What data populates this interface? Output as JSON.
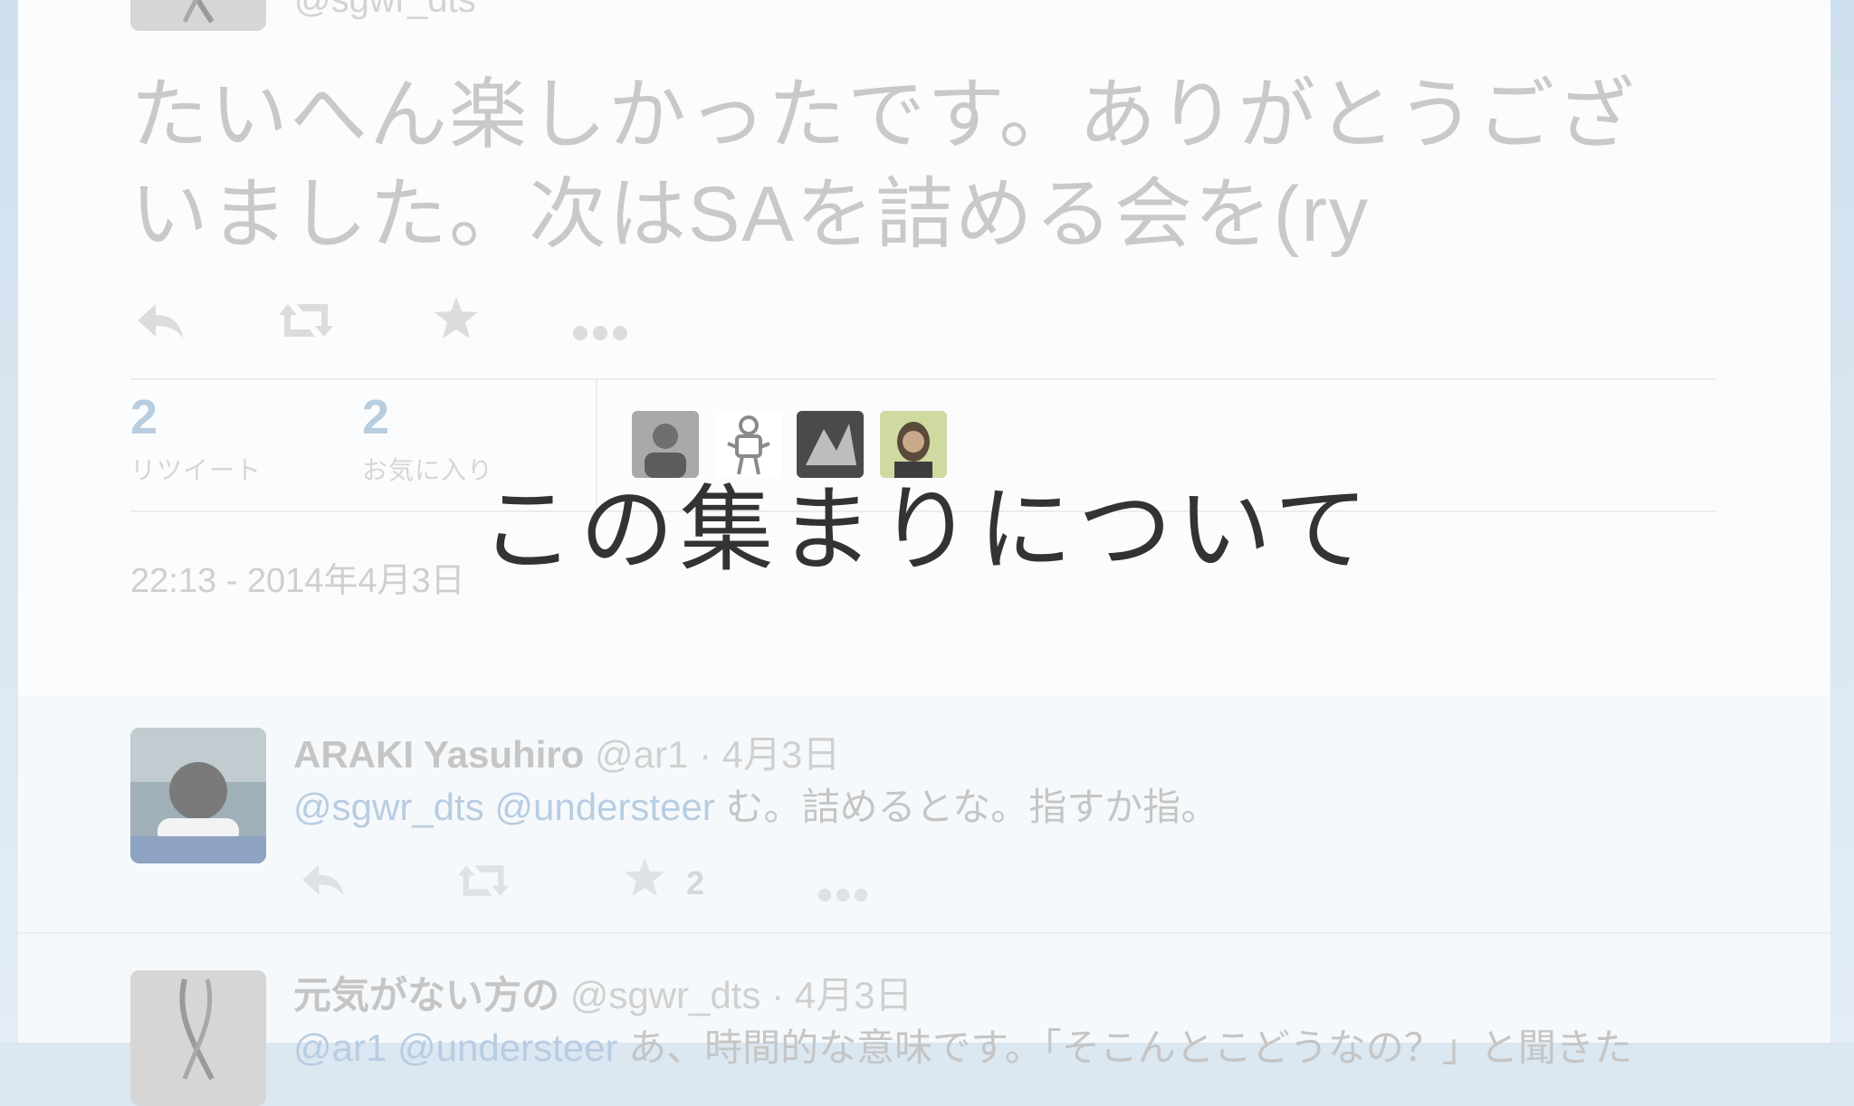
{
  "tweet": {
    "handle": "@sgwr_dts",
    "text_line1": "たいへん楽しかったです。ありがとうござ",
    "text_line2": "いました。次はSAを詰める会を(ry",
    "actions": {
      "reply_icon": "reply-icon",
      "retweet_icon": "retweet-icon",
      "favorite_icon": "star-icon",
      "more_icon": "more-icon"
    },
    "stats": {
      "retweets": {
        "count": "2",
        "label": "リツイート"
      },
      "favorites": {
        "count": "2",
        "label": "お気に入り"
      }
    },
    "timestamp": "22:13 - 2014年4月3日"
  },
  "overlay": {
    "title": "この集まりについて"
  },
  "replies": [
    {
      "name": "ARAKI Yasuhiro",
      "handle": "@ar1",
      "date": "· 4月3日",
      "mentions": "@sgwr_dts @understeer",
      "text": " む。詰めるとな。指すか指。",
      "favorite_count": "2"
    },
    {
      "name": "元気がない方の",
      "handle": "@sgwr_dts",
      "date": "· 4月3日",
      "mentions": "@ar1 @understeer",
      "text": " あ、時間的な意味です。「そこんとこどうなの？」と聞きた"
    }
  ],
  "colors": {
    "accent": "#b8cde2",
    "overlay_text": "#333333",
    "muted_text": "#c9c9c9"
  }
}
